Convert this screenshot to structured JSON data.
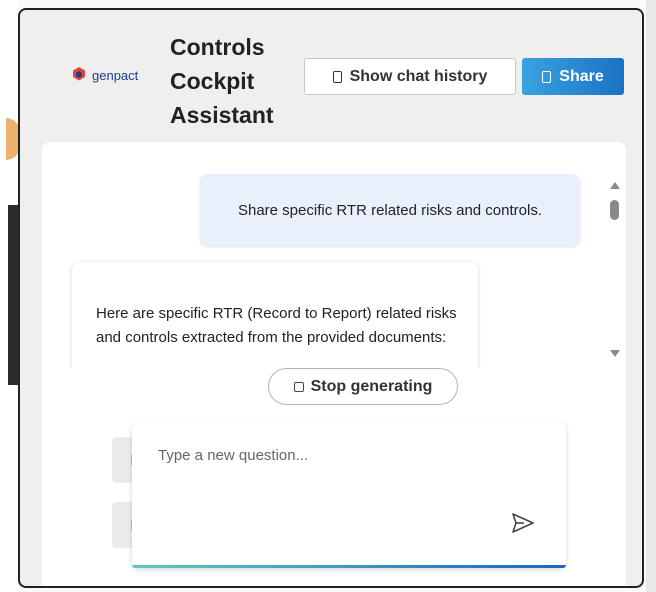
{
  "app": {
    "brand": "genpact",
    "title_lines": [
      "Controls",
      "Cockpit",
      "Assistant"
    ]
  },
  "header": {
    "history_label": "Show chat history",
    "share_label": "Share"
  },
  "chat": {
    "user_message": "Share specific RTR related risks and controls.",
    "bot_message": "Here are specific RTR (Record to Report) related risks and controls extracted from the provided documents:"
  },
  "controls": {
    "stop_label": "Stop generating"
  },
  "composer": {
    "placeholder": "Type a new question..."
  },
  "colors": {
    "share_gradient_start": "#3aa2e0",
    "share_gradient_end": "#1a72c4",
    "user_bubble": "#e8f1fb",
    "brand_blue": "#1d3d8f",
    "brand_red": "#e2463a"
  },
  "icons": {
    "history": "square-icon",
    "share": "square-icon",
    "stop": "stop-square-icon",
    "send": "send-icon"
  }
}
